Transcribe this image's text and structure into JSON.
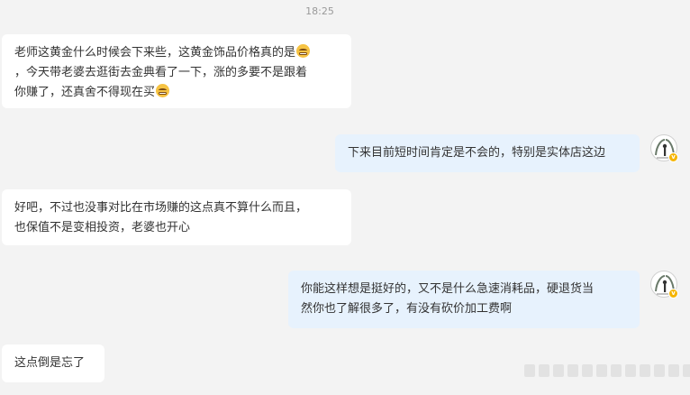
{
  "chat": {
    "timestamp": "18:25",
    "messages": [
      {
        "side": "left",
        "lines": [
          "老师这黄金什么时候会下来些，这黄金饰品价格真的是",
          "，今天带老婆去逛街去金典看了一下，涨的多要不是跟着",
          "你赚了，还真舍不得现在买"
        ],
        "emojis": [
          "laughing-tears-emoji",
          "grimace-emoji"
        ]
      },
      {
        "side": "right",
        "lines": [
          "下来目前短时间肯定是不会的，特别是实体店这边"
        ]
      },
      {
        "side": "left",
        "lines": [
          "好吧，不过也没事对比在市场赚的这点真不算什么而且，",
          "也保值不是变相投资，老婆也开心"
        ]
      },
      {
        "side": "right",
        "lines": [
          "你能这样想是挺好的，又不是什么急速消耗品，硬退货当",
          "然你也了解很多了，有没有砍价加工费啊"
        ]
      },
      {
        "side": "left",
        "lines": [
          "这点倒是忘了"
        ]
      }
    ]
  },
  "avatar": {
    "icon": "user-avatar-icon",
    "badge_icon": "verified-badge-icon",
    "badge_color": "#f5b400"
  },
  "colors": {
    "background": "#f3f3f3",
    "left_bubble": "#ffffff",
    "right_bubble": "#e7f2fd",
    "text": "#333333",
    "timestamp": "#9a9a9a"
  }
}
